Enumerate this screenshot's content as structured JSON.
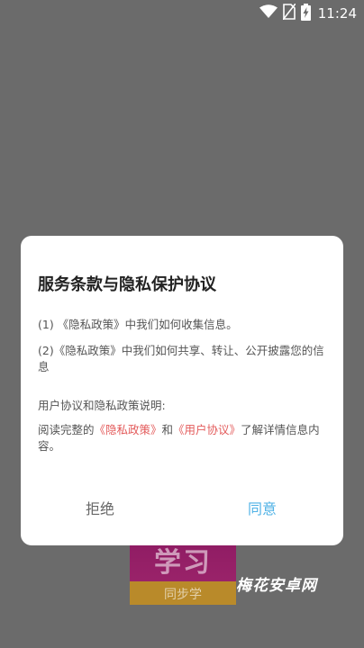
{
  "status_bar": {
    "time": "11:24",
    "icons": [
      "wifi-icon",
      "no-sim-icon",
      "battery-charging-icon"
    ]
  },
  "background_app": {
    "icon_title": "学习",
    "icon_subtitle": "同步学"
  },
  "watermark": "梅花安卓网",
  "dialog": {
    "title": "服务条款与隐私保护协议",
    "item1": "(1) 《隐私政策》中我们如何收集信息。",
    "item2": "(2)《隐私政策》中我们如何共享、转让、公开披露您的信息",
    "explanation_heading": "用户协议和隐私政策说明:",
    "read_prefix": "阅读完整的",
    "privacy_link": "《隐私政策》",
    "and_text": "和",
    "user_agreement_link": "《用户协议》",
    "read_suffix": "了解详情信息内容。",
    "reject_label": "拒绝",
    "agree_label": "同意"
  },
  "colors": {
    "scrim": "#6b6b6b",
    "link": "#e35b5b",
    "agree": "#4fb2e6",
    "reject": "#666666"
  }
}
